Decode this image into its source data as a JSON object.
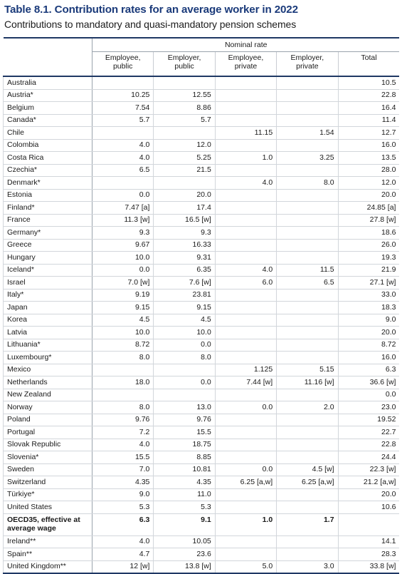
{
  "title": "Table 8.1. Contribution rates for an average worker in 2022",
  "subtitle": "Contributions to mandatory and quasi-mandatory pension schemes",
  "colors": {
    "title": "#1a3a7a",
    "rule": "#1f3864",
    "grid": "#d2d6db",
    "text": "#1a1a1a"
  },
  "table": {
    "group_header": "Nominal rate",
    "column_headers": [
      "",
      "Employee,\npublic",
      "Employer,\npublic",
      "Employee,\nprivate",
      "Employer,\nprivate",
      "Total"
    ],
    "column_headers_lines": [
      {
        "line1": "",
        "line2": ""
      },
      {
        "line1": "Employee,",
        "line2": "public"
      },
      {
        "line1": "Employer,",
        "line2": "public"
      },
      {
        "line1": "Employee,",
        "line2": "private"
      },
      {
        "line1": "Employer,",
        "line2": "private"
      },
      {
        "line1": "Total",
        "line2": ""
      }
    ],
    "rows": [
      {
        "country": "Australia",
        "employee_public": "",
        "employer_public": "",
        "employee_private": "",
        "employer_private": "",
        "total": "10.5"
      },
      {
        "country": "Austria*",
        "employee_public": "10.25",
        "employer_public": "12.55",
        "employee_private": "",
        "employer_private": "",
        "total": "22.8"
      },
      {
        "country": "Belgium",
        "employee_public": "7.54",
        "employer_public": "8.86",
        "employee_private": "",
        "employer_private": "",
        "total": "16.4"
      },
      {
        "country": "Canada*",
        "employee_public": "5.7",
        "employer_public": "5.7",
        "employee_private": "",
        "employer_private": "",
        "total": "11.4"
      },
      {
        "country": "Chile",
        "employee_public": "",
        "employer_public": "",
        "employee_private": "11.15",
        "employer_private": "1.54",
        "total": "12.7"
      },
      {
        "country": "Colombia",
        "employee_public": "4.0",
        "employer_public": "12.0",
        "employee_private": "",
        "employer_private": "",
        "total": "16.0"
      },
      {
        "country": "Costa Rica",
        "employee_public": "4.0",
        "employer_public": "5.25",
        "employee_private": "1.0",
        "employer_private": "3.25",
        "total": "13.5"
      },
      {
        "country": "Czechia*",
        "employee_public": "6.5",
        "employer_public": "21.5",
        "employee_private": "",
        "employer_private": "",
        "total": "28.0"
      },
      {
        "country": "Denmark*",
        "employee_public": "",
        "employer_public": "",
        "employee_private": "4.0",
        "employer_private": "8.0",
        "total": "12.0"
      },
      {
        "country": "Estonia",
        "employee_public": "0.0",
        "employer_public": "20.0",
        "employee_private": "",
        "employer_private": "",
        "total": "20.0"
      },
      {
        "country": "Finland*",
        "employee_public": "7.47 [a]",
        "employer_public": "17.4",
        "employee_private": "",
        "employer_private": "",
        "total": "24.85 [a]"
      },
      {
        "country": "France",
        "employee_public": "11.3 [w]",
        "employer_public": "16.5 [w]",
        "employee_private": "",
        "employer_private": "",
        "total": "27.8 [w]"
      },
      {
        "country": "Germany*",
        "employee_public": "9.3",
        "employer_public": "9.3",
        "employee_private": "",
        "employer_private": "",
        "total": "18.6"
      },
      {
        "country": "Greece",
        "employee_public": "9.67",
        "employer_public": "16.33",
        "employee_private": "",
        "employer_private": "",
        "total": "26.0"
      },
      {
        "country": "Hungary",
        "employee_public": "10.0",
        "employer_public": "9.31",
        "employee_private": "",
        "employer_private": "",
        "total": "19.3"
      },
      {
        "country": "Iceland*",
        "employee_public": "0.0",
        "employer_public": "6.35",
        "employee_private": "4.0",
        "employer_private": "11.5",
        "total": "21.9"
      },
      {
        "country": "Israel",
        "employee_public": "7.0 [w]",
        "employer_public": "7.6 [w]",
        "employee_private": "6.0",
        "employer_private": "6.5",
        "total": "27.1 [w]"
      },
      {
        "country": "Italy*",
        "employee_public": "9.19",
        "employer_public": "23.81",
        "employee_private": "",
        "employer_private": "",
        "total": "33.0"
      },
      {
        "country": "Japan",
        "employee_public": "9.15",
        "employer_public": "9.15",
        "employee_private": "",
        "employer_private": "",
        "total": "18.3"
      },
      {
        "country": "Korea",
        "employee_public": "4.5",
        "employer_public": "4.5",
        "employee_private": "",
        "employer_private": "",
        "total": "9.0"
      },
      {
        "country": "Latvia",
        "employee_public": "10.0",
        "employer_public": "10.0",
        "employee_private": "",
        "employer_private": "",
        "total": "20.0"
      },
      {
        "country": "Lithuania*",
        "employee_public": "8.72",
        "employer_public": "0.0",
        "employee_private": "",
        "employer_private": "",
        "total": "8.72"
      },
      {
        "country": "Luxembourg*",
        "employee_public": "8.0",
        "employer_public": "8.0",
        "employee_private": "",
        "employer_private": "",
        "total": "16.0"
      },
      {
        "country": "Mexico",
        "employee_public": "",
        "employer_public": "",
        "employee_private": "1.125",
        "employer_private": "5.15",
        "total": "6.3"
      },
      {
        "country": "Netherlands",
        "employee_public": "18.0",
        "employer_public": "0.0",
        "employee_private": "7.44 [w]",
        "employer_private": "11.16 [w]",
        "total": "36.6 [w]"
      },
      {
        "country": "New Zealand",
        "employee_public": "",
        "employer_public": "",
        "employee_private": "",
        "employer_private": "",
        "total": "0.0"
      },
      {
        "country": "Norway",
        "employee_public": "8.0",
        "employer_public": "13.0",
        "employee_private": "0.0",
        "employer_private": "2.0",
        "total": "23.0"
      },
      {
        "country": "Poland",
        "employee_public": "9.76",
        "employer_public": "9.76",
        "employee_private": "",
        "employer_private": "",
        "total": "19.52"
      },
      {
        "country": "Portugal",
        "employee_public": "7.2",
        "employer_public": "15.5",
        "employee_private": "",
        "employer_private": "",
        "total": "22.7"
      },
      {
        "country": "Slovak Republic",
        "employee_public": "4.0",
        "employer_public": "18.75",
        "employee_private": "",
        "employer_private": "",
        "total": "22.8"
      },
      {
        "country": "Slovenia*",
        "employee_public": "15.5",
        "employer_public": "8.85",
        "employee_private": "",
        "employer_private": "",
        "total": "24.4"
      },
      {
        "country": "Sweden",
        "employee_public": "7.0",
        "employer_public": "10.81",
        "employee_private": "0.0",
        "employer_private": "4.5 [w]",
        "total": "22.3 [w]"
      },
      {
        "country": "Switzerland",
        "employee_public": "4.35",
        "employer_public": "4.35",
        "employee_private": "6.25 [a,w]",
        "employer_private": "6.25 [a,w]",
        "total": "21.2 [a,w]"
      },
      {
        "country": "Türkiye*",
        "employee_public": "9.0",
        "employer_public": "11.0",
        "employee_private": "",
        "employer_private": "",
        "total": "20.0"
      },
      {
        "country": "United States",
        "employee_public": "5.3",
        "employer_public": "5.3",
        "employee_private": "",
        "employer_private": "",
        "total": "10.6"
      },
      {
        "country": "OECD35, effective at average wage",
        "employee_public": "6.3",
        "employer_public": "9.1",
        "employee_private": "1.0",
        "employer_private": "1.7",
        "total": "",
        "bold": true
      },
      {
        "country": "Ireland**",
        "employee_public": "4.0",
        "employer_public": "10.05",
        "employee_private": "",
        "employer_private": "",
        "total": "14.1"
      },
      {
        "country": "Spain**",
        "employee_public": "4.7",
        "employer_public": "23.6",
        "employee_private": "",
        "employer_private": "",
        "total": "28.3"
      },
      {
        "country": "United Kingdom**",
        "employee_public": "12 [w]",
        "employer_public": "13.8 [w]",
        "employee_private": "5.0",
        "employer_private": "3.0",
        "total": "33.8 [w]"
      }
    ]
  }
}
